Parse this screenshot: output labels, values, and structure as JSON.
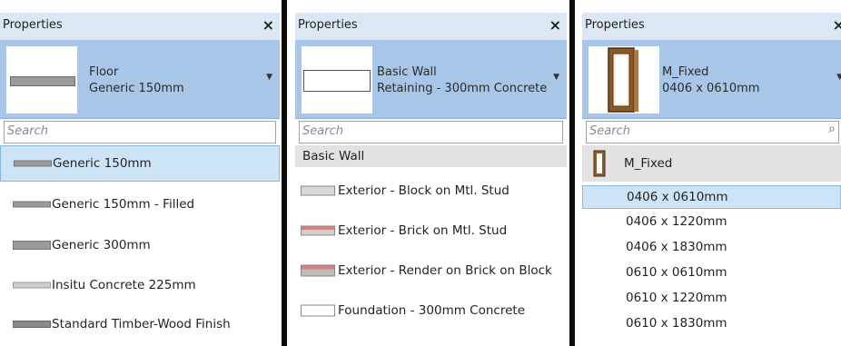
{
  "panels": [
    {
      "title": "Properties",
      "type_family": "Floor",
      "type_name": "Generic 150mm",
      "search_placeholder": "Search",
      "items": [
        {
          "label": "Generic 150mm",
          "selected": true
        },
        {
          "label": "Generic 150mm - Filled"
        },
        {
          "label": "Generic 300mm"
        },
        {
          "label": "Insitu Concrete 225mm"
        },
        {
          "label": "Standard Timber-Wood Finish"
        }
      ]
    },
    {
      "title": "Properties",
      "type_family": "Basic Wall",
      "type_name": "Retaining - 300mm Concrete",
      "search_placeholder": "Search",
      "group": "Basic Wall",
      "items": [
        {
          "label": "Exterior - Block on Mtl. Stud"
        },
        {
          "label": "Exterior - Brick on Mtl. Stud"
        },
        {
          "label": "Exterior - Render on Brick on Block"
        },
        {
          "label": "Foundation - 300mm Concrete"
        }
      ]
    },
    {
      "title": "Properties",
      "type_family": "M_Fixed",
      "type_name": "0406 x 0610mm",
      "search_placeholder": "Search",
      "group": "M_Fixed",
      "items": [
        {
          "label": "0406 x 0610mm",
          "selected": true
        },
        {
          "label": "0406 x 1220mm"
        },
        {
          "label": "0406 x 1830mm"
        },
        {
          "label": "0610 x 0610mm"
        },
        {
          "label": "0610 x 1220mm"
        },
        {
          "label": "0610 x 1830mm"
        }
      ]
    }
  ],
  "icons": {
    "close": "×",
    "dropdown": "▼",
    "search": "⌕"
  },
  "colors": {
    "title_bg": "#dbe7f4",
    "selector_bg": "#a8c6e8",
    "selected_row_bg": "#cde4f7",
    "brick": "#d88080"
  }
}
